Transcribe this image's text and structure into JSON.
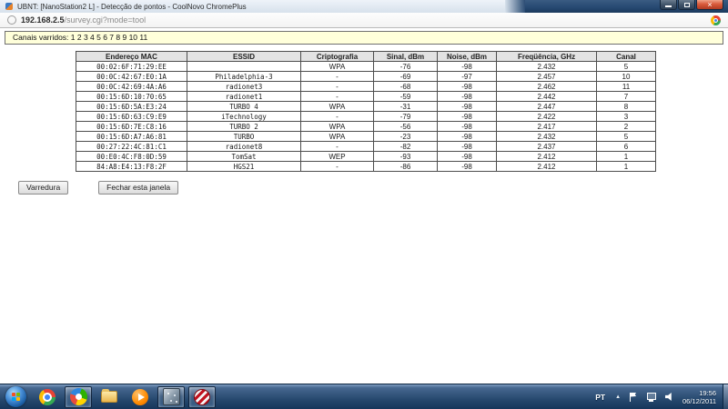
{
  "browser": {
    "title": "UBNT: [NanoStation2 L] - Detecção de pontos - CoolNovo ChromePlus",
    "url_domain": "192.168.2.5",
    "url_path": "/survey.cgi?mode=tool"
  },
  "icons": {
    "close_glyph": "×",
    "hidden_icons_glyph": "▲"
  },
  "page": {
    "banner": "Canais varridos: 1 2 3 4 5 6 7 8 9 10 11",
    "table": {
      "headers": [
        "Endereço MAC",
        "ESSID",
        "Criptografia",
        "Sinal, dBm",
        "Noise, dBm",
        "Freqüência, GHz",
        "Canal"
      ],
      "rows": [
        {
          "mac": "00:02:6F:71:29:EE",
          "essid": "",
          "crypto": "WPA",
          "signal": "-76",
          "noise": "-98",
          "freq": "2.432",
          "channel": "5",
          "highlighted": false
        },
        {
          "mac": "00:0C:42:67:E0:1A",
          "essid": "Philadelphia-3",
          "crypto": "-",
          "signal": "-69",
          "noise": "-97",
          "freq": "2.457",
          "channel": "10",
          "highlighted": false
        },
        {
          "mac": "00:0C:42:69:4A:A6",
          "essid": "radionet3",
          "crypto": "-",
          "signal": "-68",
          "noise": "-98",
          "freq": "2.462",
          "channel": "11",
          "highlighted": false
        },
        {
          "mac": "00:15:6D:10:70:65",
          "essid": "radionet1",
          "crypto": "-",
          "signal": "-59",
          "noise": "-98",
          "freq": "2.442",
          "channel": "7",
          "highlighted": false
        },
        {
          "mac": "00:15:6D:5A:E3:24",
          "essid": "TURBO 4",
          "crypto": "WPA",
          "signal": "-31",
          "noise": "-98",
          "freq": "2.447",
          "channel": "8",
          "highlighted": true
        },
        {
          "mac": "00:15:6D:63:C9:E9",
          "essid": "iTechnology",
          "crypto": "-",
          "signal": "-79",
          "noise": "-98",
          "freq": "2.422",
          "channel": "3",
          "highlighted": false
        },
        {
          "mac": "00:15:6D:7E:C8:16",
          "essid": "TURBO 2",
          "crypto": "WPA",
          "signal": "-56",
          "noise": "-98",
          "freq": "2.417",
          "channel": "2",
          "highlighted": true
        },
        {
          "mac": "00:15:6D:A7:A6:81",
          "essid": "TURBO",
          "crypto": "WPA",
          "signal": "-23",
          "noise": "-98",
          "freq": "2.432",
          "channel": "5",
          "highlighted": true
        },
        {
          "mac": "00:27:22:4C:81:C1",
          "essid": "radionet8",
          "crypto": "-",
          "signal": "-82",
          "noise": "-98",
          "freq": "2.437",
          "channel": "6",
          "highlighted": false
        },
        {
          "mac": "00:E0:4C:F8:0D:59",
          "essid": "TomSat",
          "crypto": "WEP",
          "signal": "-93",
          "noise": "-98",
          "freq": "2.412",
          "channel": "1",
          "highlighted": false
        },
        {
          "mac": "84:A8:E4:13:F8:2F",
          "essid": "HGS21",
          "crypto": "-",
          "signal": "-86",
          "noise": "-98",
          "freq": "2.412",
          "channel": "1",
          "highlighted": false
        }
      ]
    },
    "buttons": {
      "scan": "Varredura",
      "close": "Fechar esta janela"
    }
  },
  "taskbar": {
    "language": "PT",
    "time": "19:56",
    "date": "06/12/2011"
  }
}
